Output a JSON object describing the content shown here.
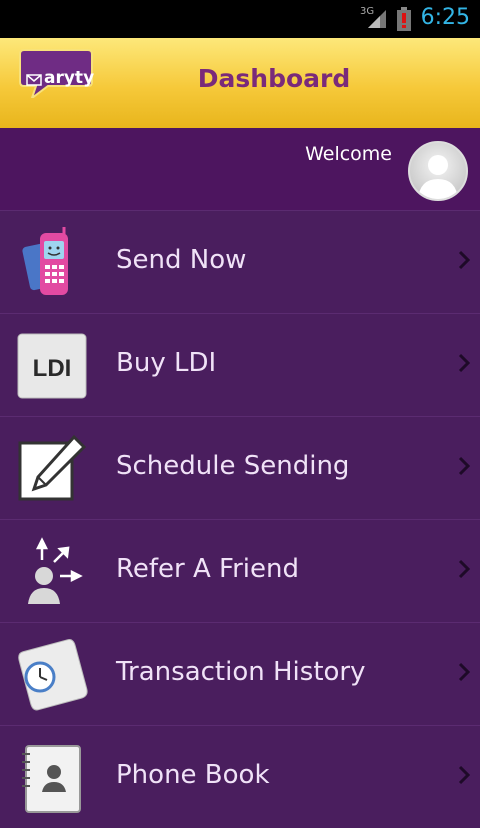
{
  "status_bar": {
    "network": "3G",
    "time": "6:25",
    "icons": [
      "signal-icon",
      "battery-alert-icon"
    ]
  },
  "header": {
    "logo_text": "aryty",
    "title": "Dashboard"
  },
  "welcome": {
    "text": "Welcome"
  },
  "menu": {
    "items": [
      {
        "label": "Send Now",
        "icon": "phone-icon"
      },
      {
        "label": "Buy LDI",
        "icon": "ldi-icon"
      },
      {
        "label": "Schedule Sending",
        "icon": "edit-icon"
      },
      {
        "label": "Refer A Friend",
        "icon": "refer-friend-icon"
      },
      {
        "label": "Transaction History",
        "icon": "clock-scroll-icon"
      },
      {
        "label": "Phone Book",
        "icon": "phone-book-icon"
      }
    ]
  },
  "colors": {
    "accent_title": "#7a2a7a",
    "background": "#4a1e5e",
    "header_gold": "#f6c93a",
    "time_blue": "#33b5e5"
  }
}
